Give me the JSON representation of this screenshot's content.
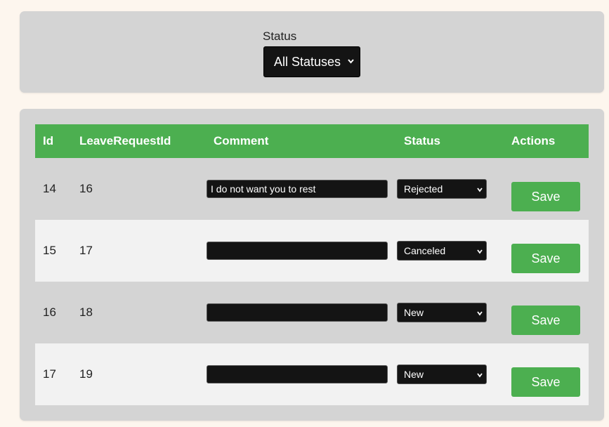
{
  "filter": {
    "label": "Status",
    "selected": "All Statuses"
  },
  "table": {
    "headers": [
      "Id",
      "LeaveRequestId",
      "Comment",
      "Status",
      "Actions"
    ],
    "rows": [
      {
        "id": "14",
        "leave_request_id": "16",
        "comment": "I do not want you to rest",
        "status": "Rejected",
        "action": "Save"
      },
      {
        "id": "15",
        "leave_request_id": "17",
        "comment": "",
        "status": "Canceled",
        "action": "Save"
      },
      {
        "id": "16",
        "leave_request_id": "18",
        "comment": "",
        "status": "New",
        "action": "Save"
      },
      {
        "id": "17",
        "leave_request_id": "19",
        "comment": "",
        "status": "New",
        "action": "Save"
      }
    ]
  },
  "colors": {
    "accent": "#4caf50",
    "panel": "#d4d4d4",
    "page_background": "#fdf6ee",
    "control_background": "#141414",
    "row_alt": "#f2f2f2"
  },
  "icons": {
    "select_arrow": "chevron-down-icon"
  }
}
